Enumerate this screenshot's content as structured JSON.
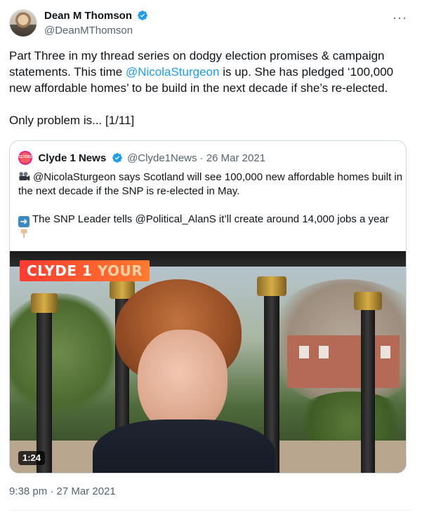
{
  "author": {
    "name": "Dean M Thomson",
    "handle": "@DeanMThomson",
    "verified": true
  },
  "tweet": {
    "line1_pre": "Part Three in my thread series on dodgy election promises & campaign statements. This time ",
    "mention": "@NicolaSturgeon",
    "line1_post": " is up. She has pledged ‘100,000 new affordable homes’ to be build in the next decade if she’s re-elected.",
    "line2": "Only problem is... [1/11]",
    "timestamp": "9:38 pm · 27 Mar 2021"
  },
  "quoted": {
    "avatar_text": "CLYDE1",
    "name": "Clyde 1 News",
    "verified": true,
    "handle_date": "@Clyde1News · 26 Mar 2021",
    "line1": "@NicolaSturgeon says Scotland will see 100,000 new affordable homes built in the next decade if the SNP is re-elected in May.",
    "line2": "The SNP Leader tells @Political_AlanS it’ll create around 14,000 jobs a year",
    "icons": [
      "movie-camera-icon",
      "right-arrow-icon",
      "pointing-down-icon"
    ]
  },
  "video": {
    "logo_text": "CLYDE 1",
    "logo_suffix": "YOUR",
    "duration": "1:24"
  },
  "colors": {
    "accent": "#1d9bf0",
    "secondary_text": "#536471",
    "border": "#cfd9de"
  }
}
